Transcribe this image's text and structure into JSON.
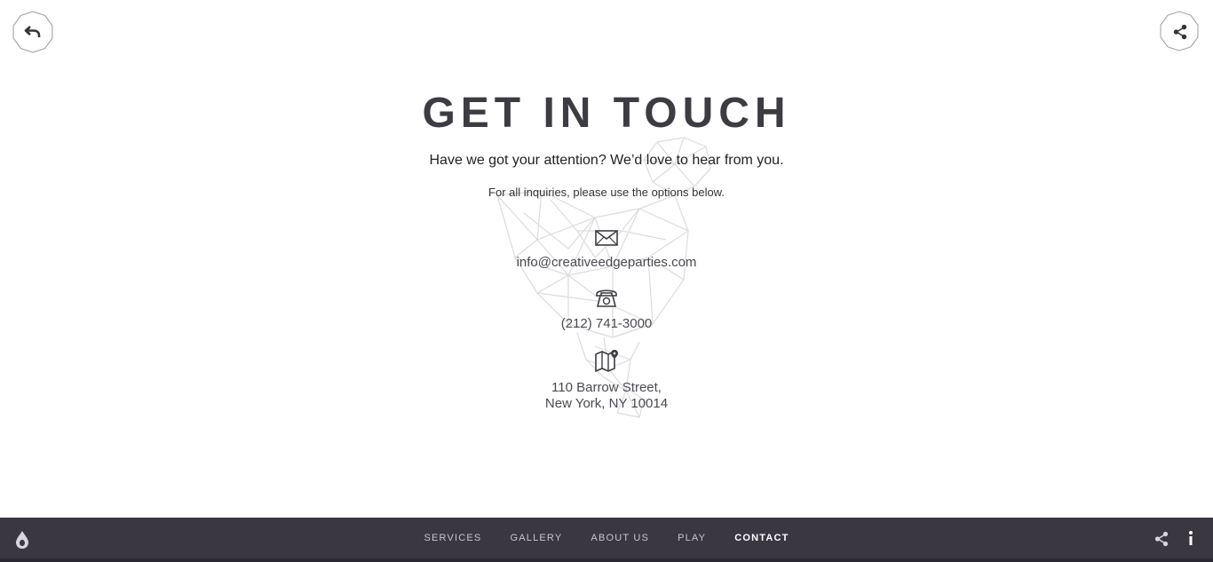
{
  "header": {
    "back_icon": "undo-arrow-icon",
    "share_icon": "share-icon"
  },
  "contact": {
    "title": "GET IN TOUCH",
    "subtitle": "Have we got your attention? We’d love to hear from you.",
    "note": "For all inquiries, please use the options below.",
    "email": "info@creativeedgeparties.com",
    "phone": "(212) 741-3000",
    "address_line1": "110 Barrow Street,",
    "address_line2": "New York, NY 10014",
    "icons": [
      "envelope-icon",
      "telephone-icon",
      "map-pin-icon"
    ],
    "background_art": "low-poly-chicken-illustration"
  },
  "footer": {
    "nav": [
      {
        "label": "SERVICES"
      },
      {
        "label": "GALLERY"
      },
      {
        "label": "ABOUT US"
      },
      {
        "label": "PLAY"
      },
      {
        "label": "CONTACT"
      }
    ],
    "active_item": "CONTACT",
    "background_color": "#3a3740"
  },
  "colors": {
    "text_dark": "#3d3c42",
    "footer_bg": "#3a3740",
    "nav_text": "#c8c6cc",
    "nav_active": "#ffffff"
  }
}
